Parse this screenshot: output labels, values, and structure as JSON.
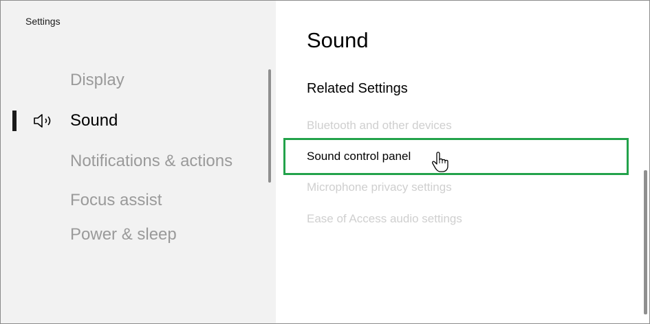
{
  "window": {
    "title": "Settings"
  },
  "sidebar": {
    "items": [
      {
        "label": "Display",
        "active": false
      },
      {
        "label": "Sound",
        "active": true,
        "icon": "speaker-icon"
      },
      {
        "label": "Notifications & actions",
        "active": false
      },
      {
        "label": "Focus assist",
        "active": false
      },
      {
        "label": "Power & sleep",
        "active": false
      }
    ]
  },
  "main": {
    "title": "Sound",
    "related_settings": {
      "heading": "Related Settings",
      "links": [
        {
          "label": "Bluetooth and other devices"
        },
        {
          "label": "Sound control panel",
          "highlighted": true
        },
        {
          "label": "Microphone privacy settings"
        },
        {
          "label": "Ease of Access audio settings"
        }
      ]
    }
  },
  "annotation": {
    "highlight_color": "#22a24a",
    "cursor": "hand-pointer-icon"
  }
}
